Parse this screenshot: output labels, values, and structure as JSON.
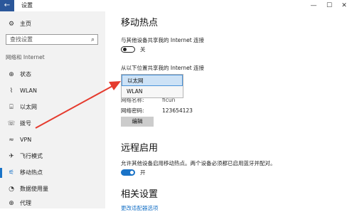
{
  "window": {
    "back_glyph": "←",
    "title": "设置",
    "minimize": "—",
    "maximize": "☐",
    "close": "✕"
  },
  "sidebar": {
    "home": {
      "icon": "home-icon",
      "glyph": "⚙",
      "label": "主页"
    },
    "search_placeholder": "查找设置",
    "section": "网络和 Internet",
    "items": [
      {
        "name": "status",
        "icon": "globe-icon",
        "glyph": "⊕",
        "label": "状态"
      },
      {
        "name": "wlan",
        "icon": "wifi-signal-icon",
        "glyph": "⌇",
        "label": "WLAN"
      },
      {
        "name": "ethernet",
        "icon": "ethernet-icon",
        "glyph": "⌸",
        "label": "以太网"
      },
      {
        "name": "dialup",
        "icon": "dialup-icon",
        "glyph": "☏",
        "label": "拨号"
      },
      {
        "name": "vpn",
        "icon": "vpn-icon",
        "glyph": "≈",
        "label": "VPN"
      },
      {
        "name": "airplane",
        "icon": "airplane-icon",
        "glyph": "✈",
        "label": "飞行模式"
      },
      {
        "name": "hotspot",
        "icon": "hotspot-icon",
        "glyph": "⚟",
        "label": "移动热点",
        "active": true
      },
      {
        "name": "data-usage",
        "icon": "data-usage-icon",
        "glyph": "◔",
        "label": "数据使用量"
      },
      {
        "name": "proxy",
        "icon": "proxy-icon",
        "glyph": "⊕",
        "label": "代理"
      }
    ]
  },
  "main": {
    "title": "移动热点",
    "share_label": "与其他设备共享我的 Internet 连接",
    "share_toggle": {
      "state": "off",
      "label": "关"
    },
    "share_from_label": "从以下位置共享我的 Internet 连接",
    "share_from_dropdown": {
      "options": [
        "以太网",
        "WLAN"
      ],
      "selected": "以太网"
    },
    "network_name_label": "网络名称:",
    "network_name_partial": "ficun",
    "network_password_label": "网络密码:",
    "network_password": "123654123",
    "edit_button": "编辑",
    "remote_title": "远程启用",
    "remote_desc": "允许其他设备启用移动热点。两个设备必须都已启用蓝牙并配对。",
    "remote_toggle": {
      "state": "on",
      "label": "开"
    },
    "related_title": "相关设置",
    "related_link": "更改适配器选项"
  },
  "colors": {
    "accent": "#1a73c7",
    "arrow": "#e53b2e",
    "sidebar_bg": "#f2f2f2"
  }
}
